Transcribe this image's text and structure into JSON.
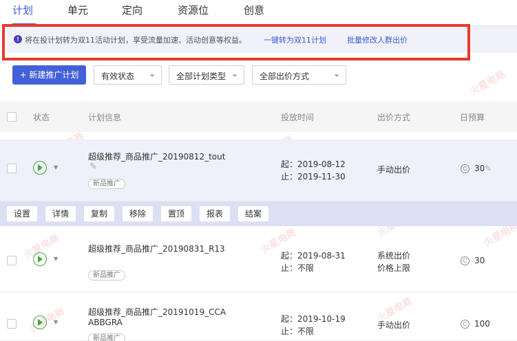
{
  "tabs": [
    {
      "label": "计划"
    },
    {
      "label": "单元"
    },
    {
      "label": "定向"
    },
    {
      "label": "资源位"
    },
    {
      "label": "创意"
    }
  ],
  "notice": {
    "text": "将在投计划转为双11活动计划，享受流量加速、活动创意等权益。",
    "link1": "一键转为双11计划",
    "link2": "批量修改人群出价"
  },
  "toolbar": {
    "new_button": "+ 新建推广计划",
    "filter_status": "有效状态",
    "filter_type": "全部计划类型",
    "filter_bid": "全部出价方式"
  },
  "table": {
    "headers": [
      "状态",
      "计划信息",
      "投放时间",
      "出价方式",
      "日预算"
    ],
    "rows": [
      {
        "name": "超级推荐_商品推广_20190812_tout",
        "tag": "新品推广",
        "start": "起：2019-08-12",
        "end": "止：2019-11-30",
        "bid": [
          "手动出价"
        ],
        "budget": "30"
      },
      {
        "name": "超级推荐_商品推广_20190831_R13",
        "tag": "新品推广",
        "start": "起：2019-08-31",
        "end": "止：不限",
        "bid": [
          "系统出价",
          "价格上限"
        ],
        "budget": "30"
      },
      {
        "name": "超级推荐_商品推广_20191019_CCA",
        "name2": "ABBGRA",
        "tag": "新品推广",
        "start": "起：2019-10-19",
        "end": "止：不限",
        "bid": [
          "手动出价"
        ],
        "budget": "100"
      }
    ]
  },
  "actions": [
    "设置",
    "详情",
    "复制",
    "移除",
    "置顶",
    "报表",
    "结案"
  ],
  "watermark": "火星电商",
  "colors": {
    "accent": "#3c5bd7",
    "play": "#49a53a",
    "highlight_box": "#e8392b"
  }
}
